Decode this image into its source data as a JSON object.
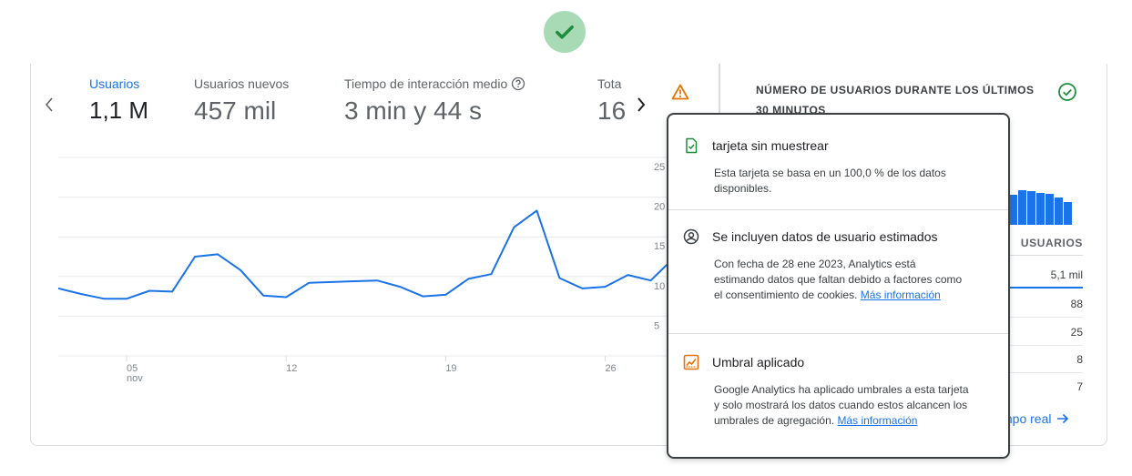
{
  "top_status": {
    "icon": "check-icon",
    "color": "#1e8e3e"
  },
  "metrics": [
    {
      "label": "Usuarios",
      "value": "1,1 M",
      "active": true
    },
    {
      "label": "Usuarios nuevos",
      "value": "457 mil",
      "active": false
    },
    {
      "label": "Tiempo de interacción medio",
      "value": "3 min y 44 s",
      "active": false,
      "help_icon": "help-circle-icon"
    },
    {
      "label": "Tota",
      "value": "16",
      "active": false
    }
  ],
  "chart_data": {
    "type": "line",
    "x_tick_labels": [
      {
        "day": "05",
        "month": "nov"
      },
      {
        "day": "12",
        "month": ""
      },
      {
        "day": "19",
        "month": ""
      },
      {
        "day": "26",
        "month": ""
      }
    ],
    "y_tick_labels": [
      "25",
      "20",
      "15",
      "10",
      "5"
    ],
    "series": [
      {
        "color": "#1a73e8",
        "values": [
          8.5,
          7.8,
          7.2,
          7.2,
          8.2,
          8.1,
          12.5,
          12.8,
          10.8,
          7.6,
          7.4,
          9.2,
          9.3,
          9.4,
          9.5,
          8.7,
          7.5,
          7.7,
          9.7,
          10.3,
          16.2,
          18.3,
          9.8,
          8.5,
          8.7,
          10.2,
          9.5,
          12.3
        ]
      }
    ],
    "ylim": [
      0,
      25
    ],
    "grid": true
  },
  "side_card": {
    "title": "NÚMERO DE USUARIOS DURANTE LOS ÚLTIMOS 30 MINUTOS",
    "column_header": "USUARIOS",
    "rows": [
      "5,1 mil",
      "88",
      "25",
      "8",
      "7"
    ],
    "link_label": "mpo real",
    "mini_bars": [
      0.82,
      0.95,
      0.92,
      0.88,
      0.85,
      0.75,
      0.62
    ]
  },
  "popover": {
    "sections": [
      {
        "icon": "file-check-icon",
        "title": "tarjeta sin muestrear",
        "body": "Esta tarjeta se basa en un 100,0 % de los datos disponibles.",
        "link": ""
      },
      {
        "icon": "account-circle-icon",
        "title": "Se incluyen datos de usuario estimados",
        "body": "Con fecha de 28 ene 2023, Analytics está estimando datos que faltan debido a factores como el consentimiento de cookies.",
        "link": "Más información"
      },
      {
        "icon": "threshold-chart-icon",
        "title": "Umbral aplicado",
        "body": "Google Analytics ha aplicado umbrales a esta tarjeta y solo mostrará los datos cuando estos alcancen los umbrales de agregación.",
        "link": "Más información"
      }
    ]
  },
  "colors": {
    "accent": "#1a73e8",
    "warning": "#e37400",
    "success": "#1e8e3e",
    "threshold": "#e8710a"
  }
}
